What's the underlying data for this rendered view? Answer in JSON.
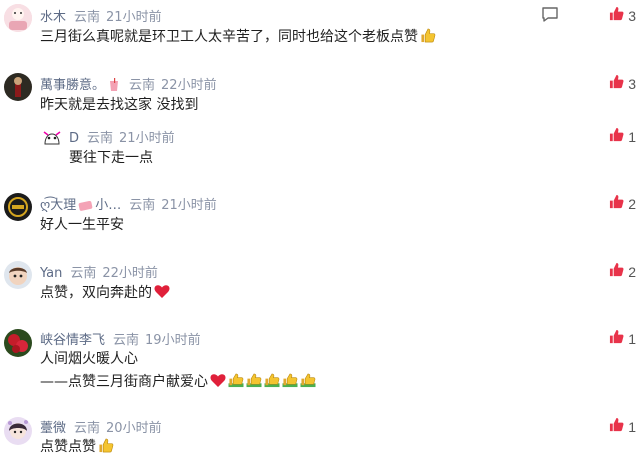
{
  "colors": {
    "like": "#e8334a",
    "name": "#5d6b86",
    "meta": "#8a93a6",
    "text": "#1f1f1f"
  },
  "icons": {
    "like": "thumbs-up-icon",
    "reply": "comment-icon",
    "heart": "red-heart-emoji",
    "thumb": "thumbs-up-emoji"
  },
  "comments": [
    {
      "name": "水木",
      "loc": "云南",
      "time": "21小时前",
      "text": "三月街么真呢就是环卫工人太辛苦了，同时也给这个老板点赞",
      "likes": "3"
    },
    {
      "name": "萬事勝意。",
      "loc": "云南",
      "time": "22小时前",
      "text": "昨天就是去找这家 没找到",
      "likes": "3"
    },
    {
      "name": "D",
      "loc": "云南",
      "time": "21小时前",
      "text": "要往下走一点",
      "likes": "1"
    },
    {
      "name": "ღ͡大理",
      "name_tail": "小…",
      "loc": "云南",
      "time": "21小时前",
      "text": "好人一生平安",
      "likes": "2"
    },
    {
      "name": "Yan",
      "loc": "云南",
      "time": "22小时前",
      "text": "点赞，双向奔赴的",
      "likes": "2"
    },
    {
      "name": "峡谷情李飞",
      "loc": "云南",
      "time": "19小时前",
      "text": "人间烟火暖人心",
      "text2": "——点赞三月街商户献爱心",
      "likes": "1"
    },
    {
      "name": "薹微",
      "loc": "云南",
      "time": "20小时前",
      "text": "点赞点赞",
      "likes": "1"
    }
  ]
}
